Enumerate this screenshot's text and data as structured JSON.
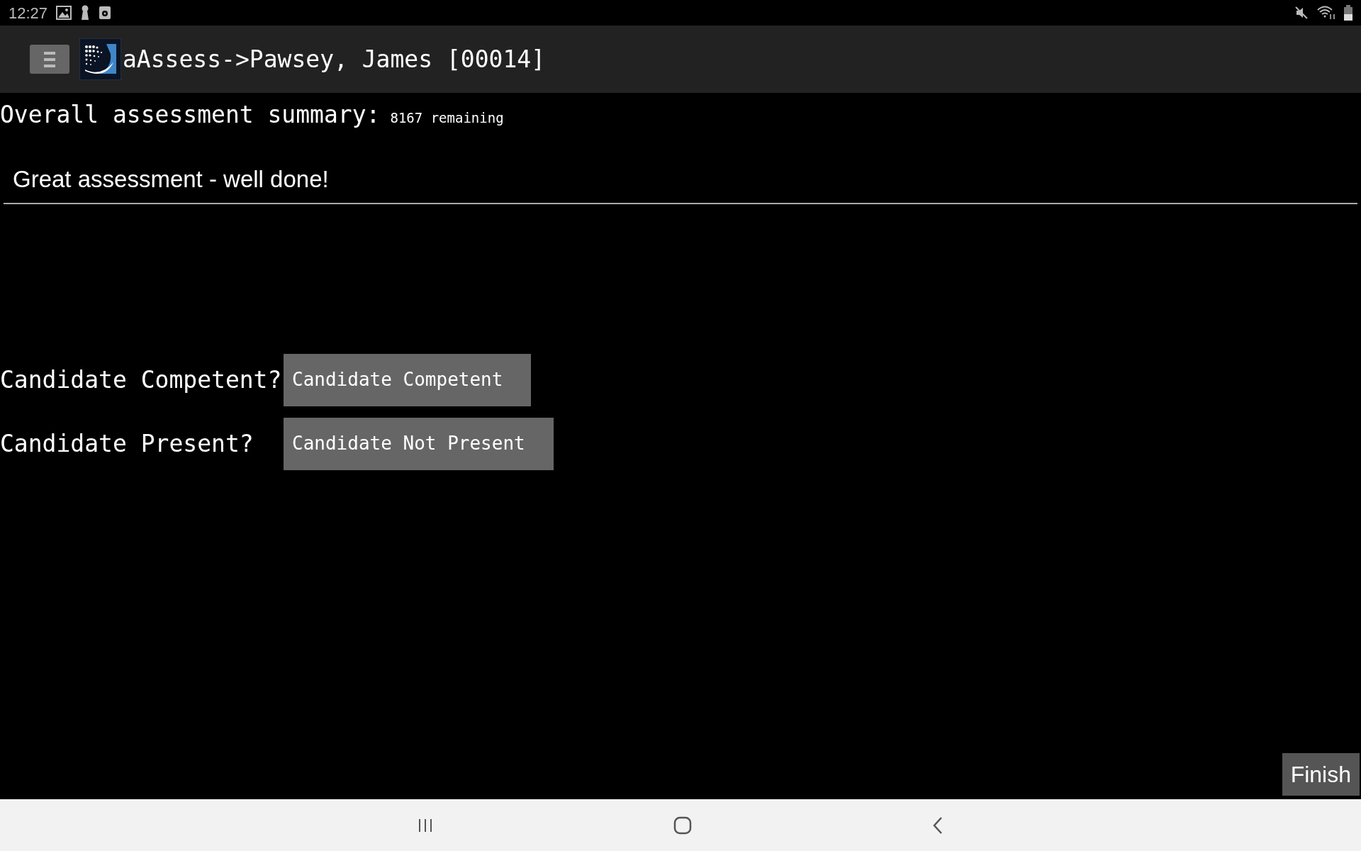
{
  "status_bar": {
    "time": "12:27"
  },
  "app_bar": {
    "title": "aAssess->Pawsey, James [00014]"
  },
  "summary": {
    "label": "Overall assessment summary:",
    "counter": "8167 remaining",
    "value": "Great assessment - well done!"
  },
  "questions": [
    {
      "label": "Candidate Competent?",
      "answer": "Candidate Competent"
    },
    {
      "label": "Candidate Present?",
      "answer": "Candidate Not Present"
    }
  ],
  "finish_button": "Finish"
}
